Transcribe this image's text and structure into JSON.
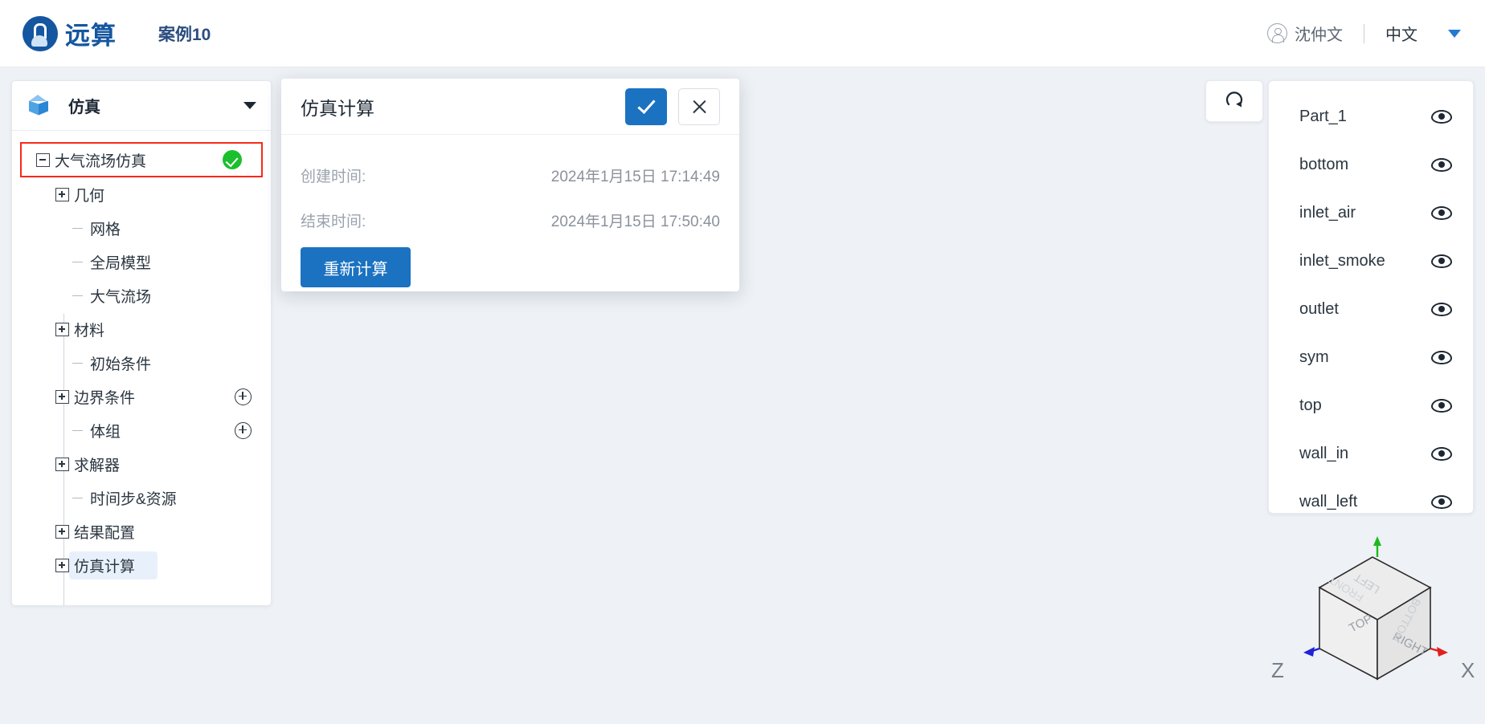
{
  "header": {
    "logo_text": "远算",
    "case_title": "案例10",
    "user_name": "沈仲文",
    "language": "中文"
  },
  "sidebar": {
    "panel_title": "仿真",
    "tree": [
      {
        "label": "大气流场仿真",
        "type": "expanded",
        "depth": 0,
        "status": "success",
        "highlighted": true
      },
      {
        "label": "几何",
        "type": "collapsed",
        "depth": 1
      },
      {
        "label": "网格",
        "type": "leaf",
        "depth": 2
      },
      {
        "label": "全局模型",
        "type": "leaf",
        "depth": 2
      },
      {
        "label": "大气流场",
        "type": "leaf",
        "depth": 2
      },
      {
        "label": "材料",
        "type": "collapsed",
        "depth": 1
      },
      {
        "label": "初始条件",
        "type": "leaf",
        "depth": 2
      },
      {
        "label": "边界条件",
        "type": "collapsed",
        "depth": 1,
        "add": true
      },
      {
        "label": "体组",
        "type": "leaf",
        "depth": 2,
        "add": true
      },
      {
        "label": "求解器",
        "type": "collapsed",
        "depth": 1
      },
      {
        "label": "时间步&资源",
        "type": "leaf",
        "depth": 2
      },
      {
        "label": "结果配置",
        "type": "collapsed",
        "depth": 1
      },
      {
        "label": "仿真计算",
        "type": "collapsed",
        "depth": 1,
        "selected": true
      }
    ]
  },
  "dialog": {
    "title": "仿真计算",
    "confirm_icon": "check-icon",
    "close_icon": "close-icon",
    "rows": [
      {
        "label": "创建时间:",
        "value": "2024年1月15日 17:14:49"
      },
      {
        "label": "结束时间:",
        "value": "2024年1月15日 17:50:40"
      }
    ],
    "recalculate_label": "重新计算"
  },
  "viewport": {
    "reset_view_icon": "refresh-icon",
    "model_color": "#3d4b54"
  },
  "parts_panel": {
    "items": [
      {
        "name": "Part_1",
        "visibility_icon": "eye-icon"
      },
      {
        "name": "bottom",
        "visibility_icon": "eye-icon"
      },
      {
        "name": "inlet_air",
        "visibility_icon": "eye-icon"
      },
      {
        "name": "inlet_smoke",
        "visibility_icon": "eye-icon"
      },
      {
        "name": "outlet",
        "visibility_icon": "eye-icon"
      },
      {
        "name": "sym",
        "visibility_icon": "eye-icon"
      },
      {
        "name": "top",
        "visibility_icon": "eye-icon"
      },
      {
        "name": "wall_in",
        "visibility_icon": "eye-icon"
      },
      {
        "name": "wall_left",
        "visibility_icon": "eye-icon"
      }
    ]
  },
  "nav_cube": {
    "faces": {
      "front_left": "TOP",
      "front_right": "RIGHT",
      "top_back_left": "FRONT",
      "top_back_right": "LEFT",
      "top_right_edge": "BOTTOM"
    },
    "axis_x": "X",
    "axis_z": "Z",
    "axis_x_color": "#e02020",
    "axis_y_color": "#1db91d",
    "axis_z_color": "#2222d8"
  },
  "colors": {
    "brand": "#1456a0",
    "accent": "#1b72c0",
    "success": "#1bbf2e",
    "highlight_outline": "#f9281a",
    "canvas_bg": "#eef1f5"
  }
}
